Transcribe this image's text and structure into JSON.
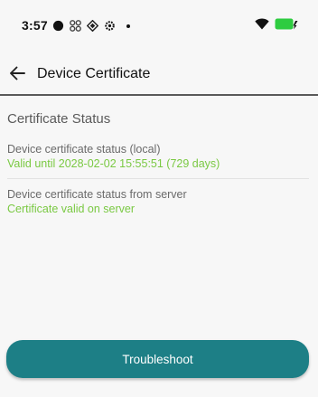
{
  "status_bar": {
    "time": "3:57",
    "left_icons": [
      "filled-circle-icon",
      "pinwheel-icon",
      "diamond-grid-icon",
      "settings-cog-icon",
      "notification-dot-icon"
    ],
    "right_icons": [
      "wifi-icon",
      "battery-charging-icon"
    ],
    "battery_color": "#2ecc40"
  },
  "app_bar": {
    "title": "Device Certificate"
  },
  "main": {
    "section_title": "Certificate Status",
    "items": [
      {
        "label": "Device certificate status (local)",
        "value": "Valid until 2028-02-02 15:55:51 (729 days)"
      },
      {
        "label": "Device certificate status from server",
        "value": "Certificate valid on server"
      }
    ],
    "value_color": "#7ac943"
  },
  "actions": {
    "troubleshoot_label": "Troubleshoot",
    "accent": "#1d7f86"
  }
}
